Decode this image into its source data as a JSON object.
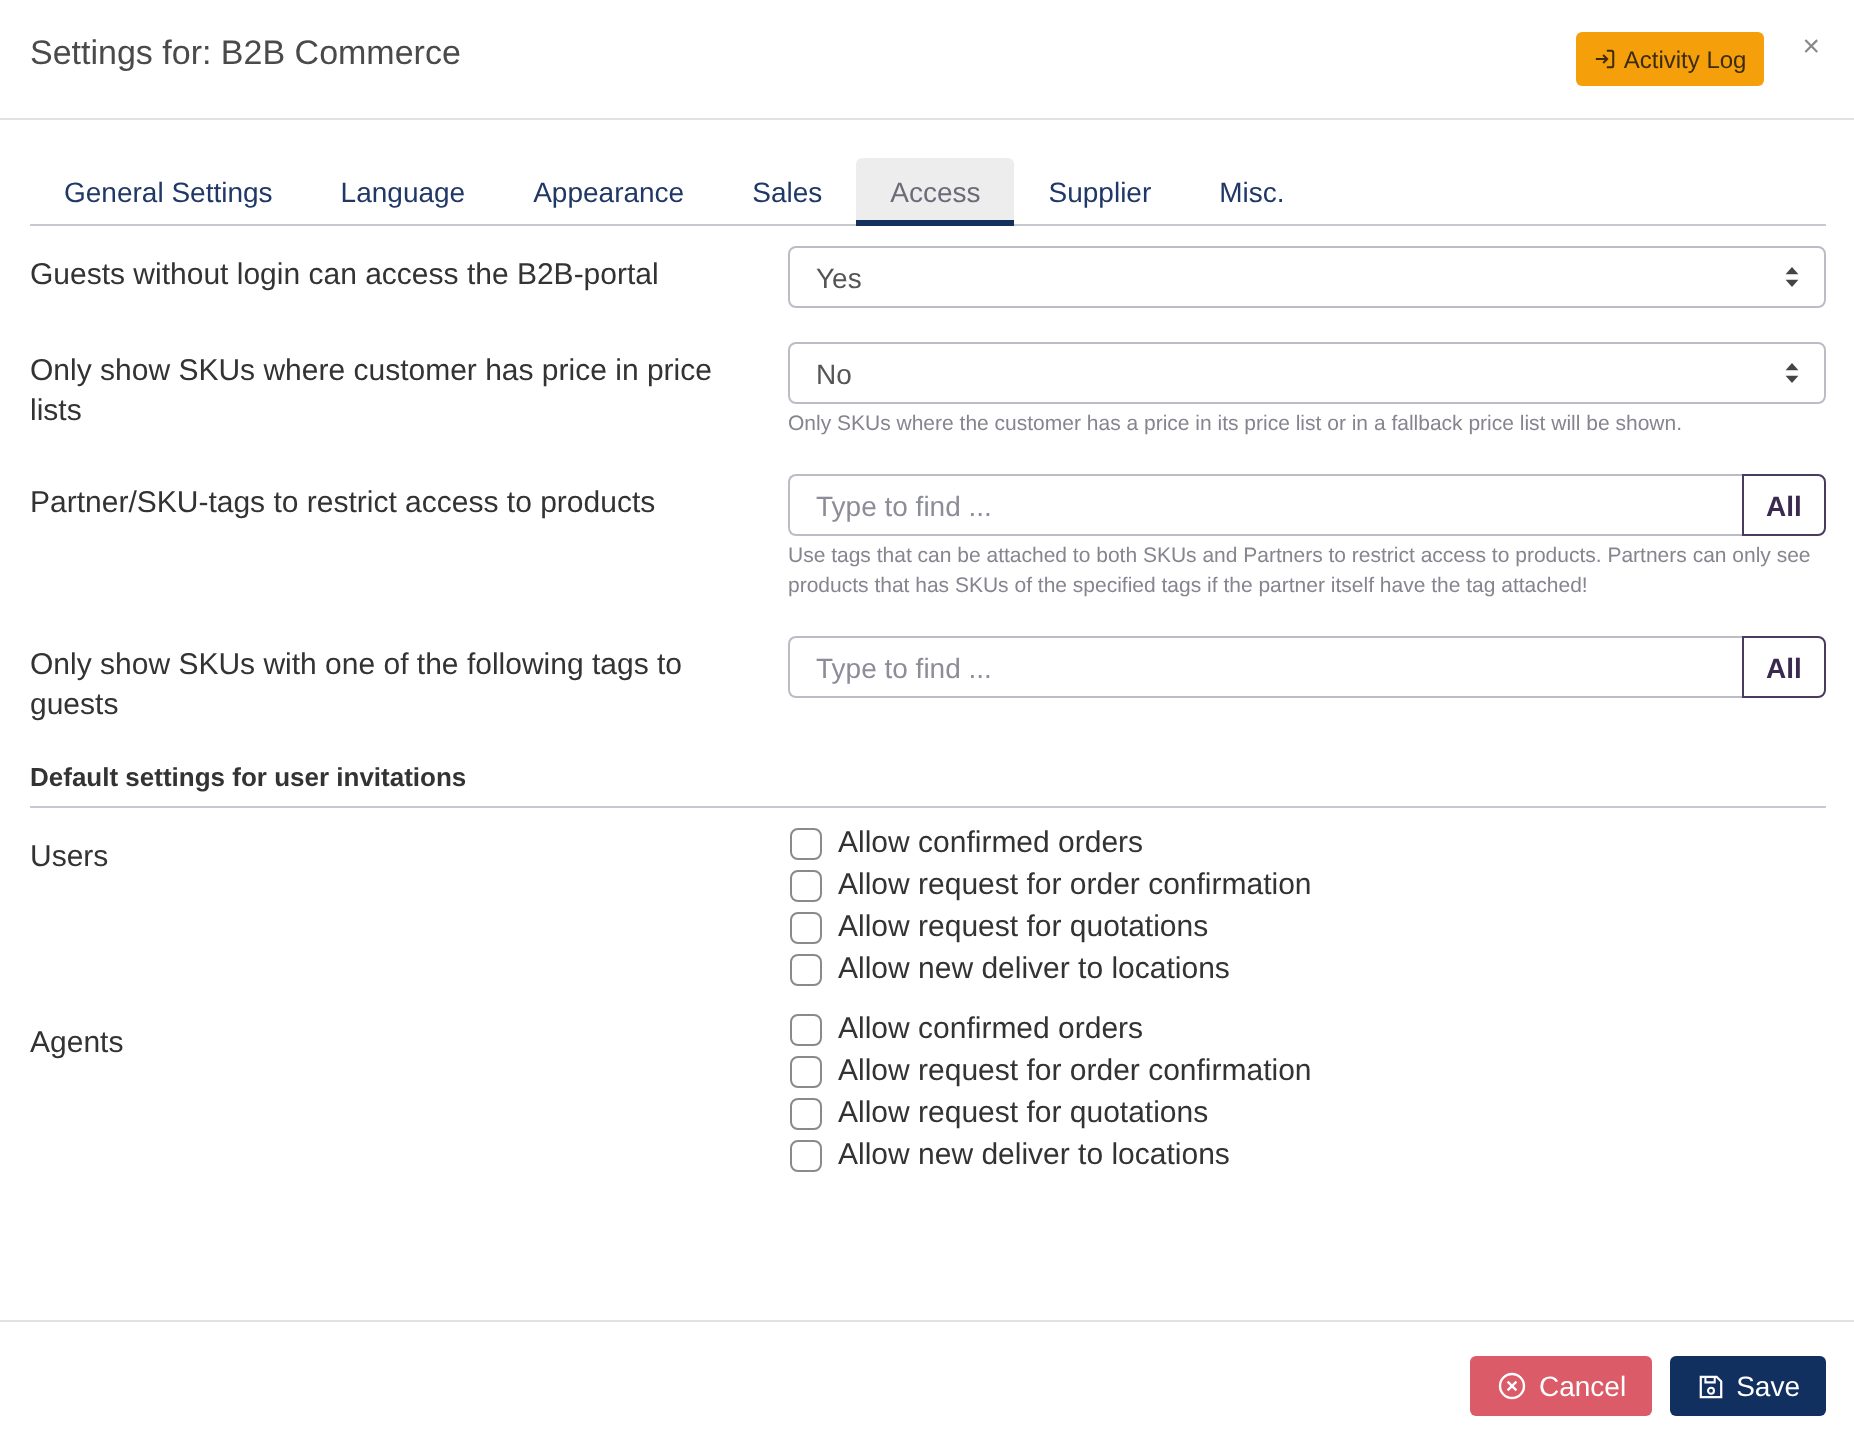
{
  "dialog": {
    "title": "Settings for: B2B Commerce",
    "activity_button": "Activity Log",
    "close": "×"
  },
  "tabs": [
    {
      "label": "General Settings",
      "selected": false
    },
    {
      "label": "Language",
      "selected": false
    },
    {
      "label": "Appearance",
      "selected": false
    },
    {
      "label": "Sales",
      "selected": false
    },
    {
      "label": "Access",
      "selected": true
    },
    {
      "label": "Supplier",
      "selected": false
    },
    {
      "label": "Misc.",
      "selected": false
    }
  ],
  "settings": [
    {
      "kind": "select",
      "label": "Guests without login can access the B2B-portal",
      "value": "Yes"
    },
    {
      "kind": "select",
      "label": "Only show SKUs where customer has price in price lists",
      "value": "No",
      "help": "Only SKUs where the customer has a price in its price list or in a fallback price list will be shown."
    },
    {
      "kind": "tag_search",
      "label": "Partner/SKU-tags to restrict access to products",
      "placeholder": "Type to find ...",
      "button": "All",
      "help": "Use tags that can be attached to both SKUs and Partners to restrict access to products. Partners can only see products that has SKUs of the specified tags if the partner itself have the tag attached!"
    },
    {
      "kind": "tag_search",
      "label": "Only show SKUs with one of the following tags to guests",
      "placeholder": "Type to find ...",
      "button": "All"
    }
  ],
  "invitation_defaults": {
    "heading": "Default settings for user invitations",
    "groups": [
      {
        "label": "Users",
        "options": [
          {
            "label": "Allow confirmed orders",
            "checked": false
          },
          {
            "label": "Allow request for order confirmation",
            "checked": false
          },
          {
            "label": "Allow request for quotations",
            "checked": false
          },
          {
            "label": "Allow new deliver to locations",
            "checked": false
          }
        ]
      },
      {
        "label": "Agents",
        "options": [
          {
            "label": "Allow confirmed orders",
            "checked": false
          },
          {
            "label": "Allow request for order confirmation",
            "checked": false
          },
          {
            "label": "Allow request for quotations",
            "checked": false
          },
          {
            "label": "Allow new deliver to locations",
            "checked": false
          }
        ]
      }
    ]
  },
  "footer": {
    "buttons": [
      {
        "kind": "cancel",
        "label": "Cancel"
      },
      {
        "kind": "save",
        "label": "Save"
      }
    ]
  }
}
